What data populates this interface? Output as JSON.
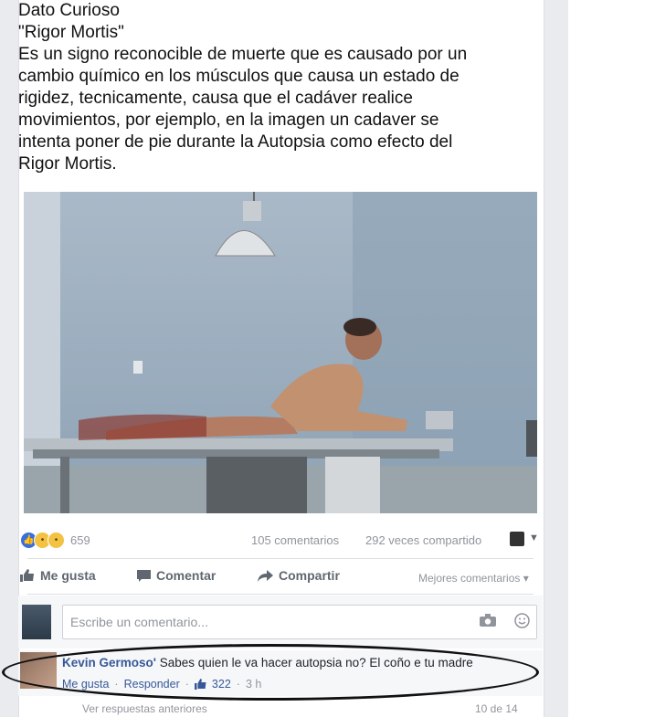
{
  "post": {
    "lines": [
      "Dato Curioso",
      "\"Rigor Mortis\"",
      "Es un signo reconocible de muerte que es causado por un",
      "cambio químico en los músculos que causa un estado de",
      "rigidez, tecnicamente, causa que el cadáver realice",
      "movimientos, por ejemplo, en la imagen un cadaver se",
      "intenta poner de pie durante la Autopsia como efecto del",
      "Rigor Mortis."
    ]
  },
  "stats": {
    "reactions_count": "659",
    "comments": "105 comentarios",
    "shares": "292 veces compartido"
  },
  "actions": {
    "like": "Me gusta",
    "comment": "Comentar",
    "share": "Compartir",
    "sort": "Mejores comentarios"
  },
  "composer": {
    "placeholder": "Escribe un comentario..."
  },
  "comment": {
    "author": "Kevin Germoso'",
    "text": "Sabes quien le va hacer autopsia no? El coño e tu madre",
    "like_label": "Me gusta",
    "reply_label": "Responder",
    "likes": "322",
    "time": "3 h"
  },
  "more": {
    "label": "Ver respuestas anteriores",
    "count": "10 de 14"
  },
  "icons": {
    "reactions": [
      "like-icon",
      "wow-icon",
      "haha-icon"
    ],
    "like_action": "thumbs-up-icon",
    "comment_action": "speech-bubble-icon",
    "share_action": "share-arrow-icon",
    "camera": "camera-icon",
    "emoji": "smile-icon"
  },
  "colors": {
    "link": "#365899",
    "muted": "#90949c",
    "background": "#e9ebee"
  }
}
